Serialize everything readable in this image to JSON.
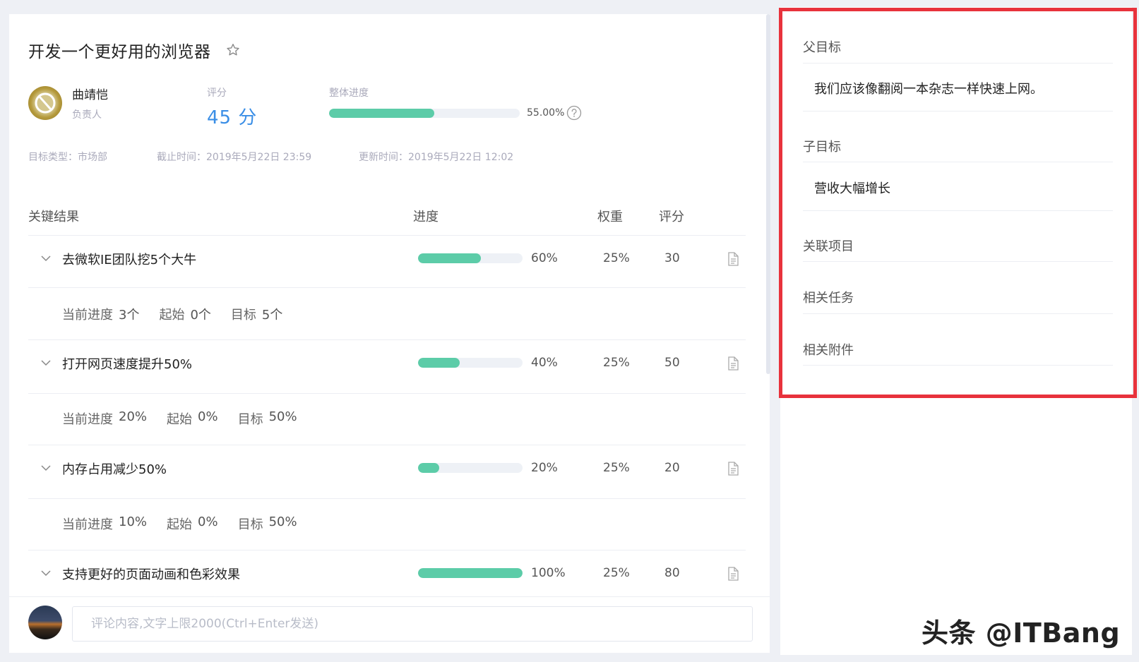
{
  "objective": {
    "title": "开发一个更好用的浏览器",
    "owner_name": "曲靖恺",
    "owner_role": "负责人",
    "score_label": "评分",
    "score_value": "45 分",
    "progress_label": "整体进度",
    "progress_fraction": 0.55,
    "progress_text": "55.00%",
    "meta": {
      "type": "目标类型：市场部",
      "deadline": "截止时间：2019年5月22日 23:59",
      "updated": "更新时间：2019年5月22日 12:02"
    }
  },
  "table": {
    "headers": {
      "key_results": "关键结果",
      "progress": "进度",
      "weight": "权重",
      "score": "评分"
    },
    "rows": [
      {
        "name": "去微软IE团队挖5个大牛",
        "progress_fraction": 0.6,
        "progress_text": "60%",
        "weight": "25%",
        "score": "30",
        "detail": {
          "current_label": "当前进度",
          "current": "3个",
          "start_label": "起始",
          "start": "0个",
          "target_label": "目标",
          "target": "5个"
        }
      },
      {
        "name": "打开网页速度提升50%",
        "progress_fraction": 0.4,
        "progress_text": "40%",
        "weight": "25%",
        "score": "50",
        "detail": {
          "current_label": "当前进度",
          "current": "20%",
          "start_label": "起始",
          "start": "0%",
          "target_label": "目标",
          "target": "50%"
        }
      },
      {
        "name": "内存占用减少50%",
        "progress_fraction": 0.2,
        "progress_text": "20%",
        "weight": "25%",
        "score": "20",
        "detail": {
          "current_label": "当前进度",
          "current": "10%",
          "start_label": "起始",
          "start": "0%",
          "target_label": "目标",
          "target": "50%"
        }
      },
      {
        "name": "支持更好的页面动画和色彩效果",
        "progress_fraction": 1.0,
        "progress_text": "100%",
        "weight": "25%",
        "score": "80"
      }
    ]
  },
  "comment": {
    "placeholder": "评论内容,文字上限2000(Ctrl+Enter发送)"
  },
  "sidebar": {
    "parent_label": "父目标",
    "parent_value": "我们应该像翻阅一本杂志一样快速上网。",
    "child_label": "子目标",
    "child_value": "营收大幅增长",
    "projects_label": "关联项目",
    "tasks_label": "相关任务",
    "attachments_label": "相关附件"
  },
  "watermark": "头条 @ITBang",
  "colors": {
    "progress_fill": "#5ccca8",
    "score_accent": "#3a8ee6",
    "highlight_frame": "#e8323c"
  }
}
